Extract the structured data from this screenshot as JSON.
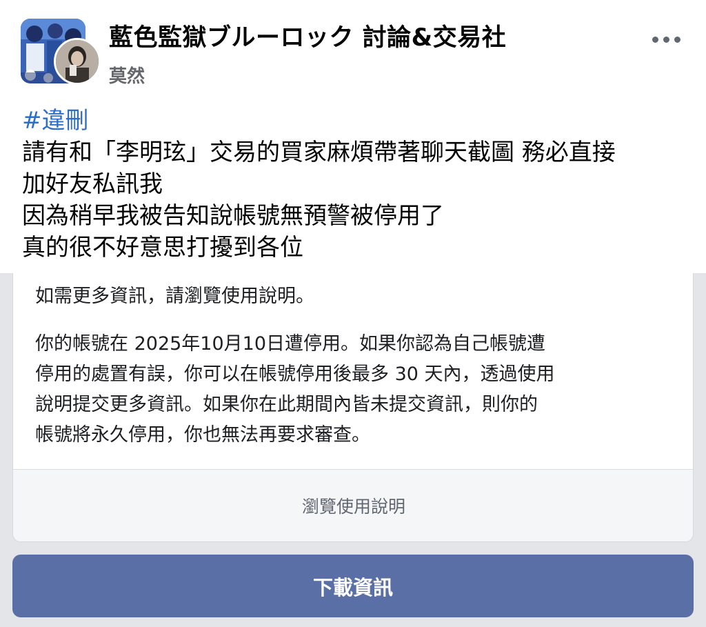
{
  "post": {
    "group_name": "藍色監獄ブルーロック 討論&交易社",
    "author": "莫然",
    "hashtag": "#違刪",
    "lines": [
      "請有和「李明玹」交易的買家麻煩帶著聊天截圖 務必直接",
      "加好友私訊我",
      "因為稍早我被告知說帳號無預警被停用了",
      "真的很不好意思打擾到各位"
    ],
    "more_icon": "more-horizontal-icon"
  },
  "notice": {
    "info_line": "如需更多資訊，請瀏覽使用說明。",
    "paragraph_lines": [
      "你的帳號在 2025年10月10日遭停用。如果你認為自己帳號遭",
      "停用的處置有誤，你可以在帳號停用後最多 30 天內，透過使用",
      "說明提交更多資訊。如果你在此期間內皆未提交資訊，則你的",
      "帳號將永久停用，你也無法再要求審查。"
    ],
    "browse_help_label": "瀏覽使用說明",
    "download_label": "下載資訊"
  },
  "colors": {
    "hashtag": "#2d6fc7",
    "download_button": "#5a6fa6",
    "secondary_text": "#65676b"
  }
}
